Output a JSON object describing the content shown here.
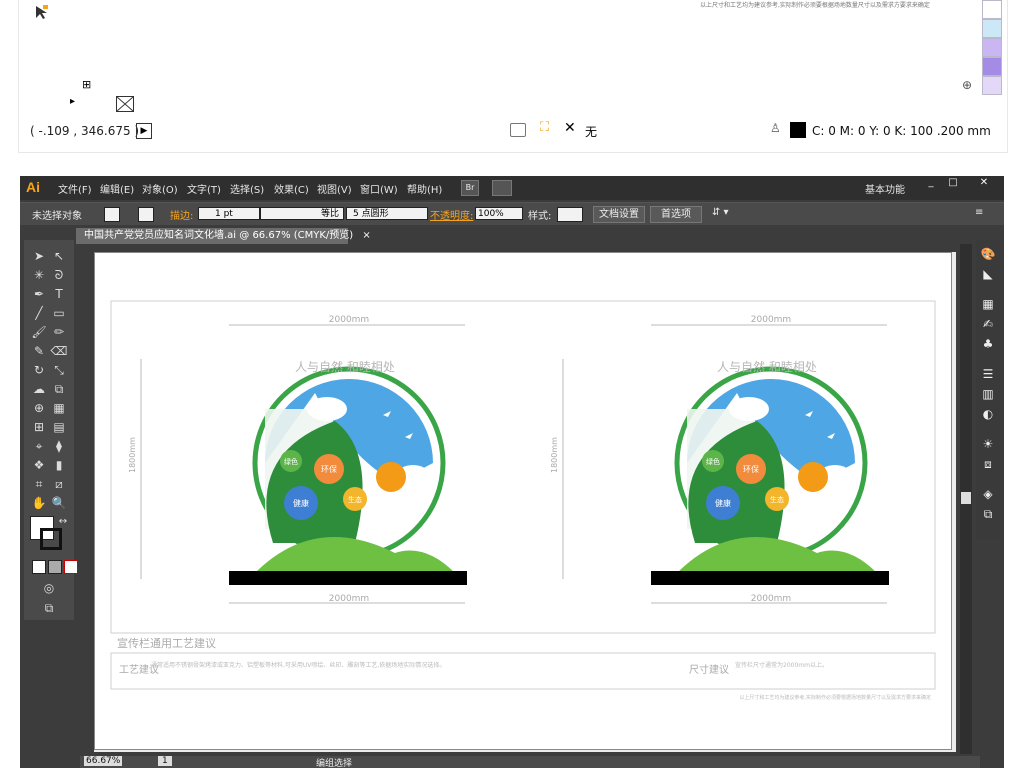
{
  "info_panel": {
    "coords": "( -.109 , 346.675 )",
    "fill_none_label": "无",
    "cmyk_value": "C: 0 M: 0 Y: 0 K: 100",
    "stroke_width": ".200 mm",
    "note_text": "以上尺寸和工艺均为建议参考,实际制作必须要根据场地数量尺寸以及需求方要求来确定",
    "swatch_colors": [
      "#ffffff",
      "#cce7f6",
      "#c9b6f3",
      "#a48be6",
      "#e3d8f7"
    ]
  },
  "app": {
    "logo": "Ai",
    "menus": [
      "文件(F)",
      "编辑(E)",
      "对象(O)",
      "文字(T)",
      "选择(S)",
      "效果(C)",
      "视图(V)",
      "窗口(W)",
      "帮助(H)"
    ],
    "br_label": "Br",
    "workspace": "基本功能",
    "win_min": "_",
    "win_max": "□",
    "win_close": "✕"
  },
  "control_bar": {
    "no_selection": "未选择对象",
    "stroke_label": "描边:",
    "stroke_value": "1 pt",
    "uniform": "等比",
    "point_round": "5 点圆形",
    "opacity_label": "不透明度:",
    "opacity_value": "100%",
    "style_label": "样式:",
    "doc_settings": "文档设置",
    "preferences": "首选项"
  },
  "tab": {
    "title": "中国共产党党员应知名词文化墙.ai @ 66.67% (CMYK/预览)",
    "close": "×"
  },
  "artwork": {
    "width_label": "2000mm",
    "height_label": "1800mm",
    "bottom_label": "2000mm",
    "heading_arc": "人与自然 和睦相处",
    "flowers": [
      "绿色",
      "环保",
      "健康",
      "生态"
    ],
    "section_title": "宣传栏通用工艺建议",
    "craft_label": "工艺建议",
    "size_label": "尺寸建议",
    "craft_desc": "通常适用不锈钢骨架烤漆或亚克力、铝塑板等材料,可采用UV喷绘、丝印、雕刻等工艺,依据场地实际情况选择。",
    "size_desc": "宣传栏尺寸通常为2000mm以上。",
    "footer_note": "以上尺寸和工艺均为建议参考,实际制作必须要根据场地数量尺寸以及需求方要求来确定"
  },
  "status_bar": {
    "zoom": "66.67%",
    "page": "1",
    "mode": "编组选择"
  },
  "colors": {
    "menu_bg": "#2f2f2f",
    "panel_bg": "#4a4a4a",
    "accent": "#f7a41d",
    "green": "#3aa546",
    "sky": "#4fa6e4",
    "sun": "#f39a16"
  }
}
